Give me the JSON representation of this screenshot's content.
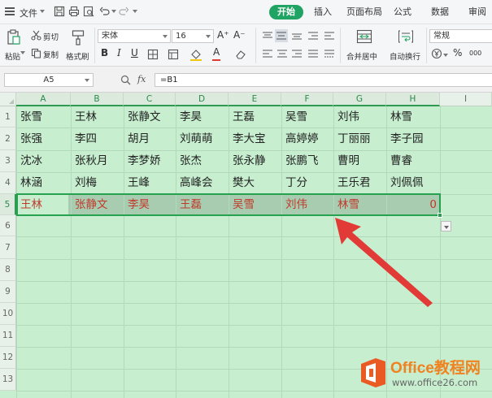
{
  "menubar": {
    "file_label": "文件",
    "tabs": [
      {
        "label": "开始",
        "active": true
      },
      {
        "label": "插入",
        "active": false
      },
      {
        "label": "页面布局",
        "active": false
      },
      {
        "label": "公式",
        "active": false
      },
      {
        "label": "数据",
        "active": false
      },
      {
        "label": "审阅",
        "active": false
      }
    ]
  },
  "ribbon": {
    "paste_label": "粘贴",
    "cut_label": "剪切",
    "copy_label": "复制",
    "format_painter_label": "格式刷",
    "font_name": "宋体",
    "font_size": "16",
    "merge_center_label": "合并居中",
    "auto_wrap_label": "自动换行",
    "number_format": "常规",
    "percent_symbol": "%",
    "thousands_label": "000",
    "bold_glyph": "B",
    "italic_glyph": "I",
    "underline_glyph": "U",
    "font_color_glyph": "A",
    "grow_font_glyph": "A⁺",
    "shrink_font_glyph": "A⁻"
  },
  "formula_bar": {
    "name_box": "A5",
    "fx_label": "fx",
    "formula": "=B1"
  },
  "sheet": {
    "columns": [
      "A",
      "B",
      "C",
      "D",
      "E",
      "F",
      "G",
      "H",
      "I"
    ],
    "rows": [
      "1",
      "2",
      "3",
      "4",
      "5",
      "6",
      "7",
      "8",
      "9",
      "10",
      "11",
      "12",
      "13"
    ],
    "data": [
      [
        "张雪",
        "王林",
        "张静文",
        "李昊",
        "王磊",
        "吴雪",
        "刘伟",
        "林雪"
      ],
      [
        "张强",
        "李四",
        "胡月",
        "刘萌萌",
        "李大宝",
        "高婷婷",
        "丁丽丽",
        "李子园"
      ],
      [
        "沈冰",
        "张秋月",
        "李梦娇",
        "张杰",
        "张永静",
        "张鹏飞",
        "曹明",
        "曹睿"
      ],
      [
        "林涵",
        "刘梅",
        "王峰",
        "高峰会",
        "樊大",
        "丁分",
        "王乐君",
        "刘佩佩"
      ],
      [
        "王林",
        "张静文",
        "李昊",
        "王磊",
        "吴雪",
        "刘伟",
        "林雪",
        "0"
      ]
    ],
    "selected_row": "5",
    "selected_text_color": "#c0392b",
    "grid_color": "#c6eecf"
  },
  "watermark": {
    "brand": "Office教程网",
    "url": "www.office26.com"
  },
  "colors": {
    "accent": "#1fa463",
    "arrow": "#e23a36"
  }
}
